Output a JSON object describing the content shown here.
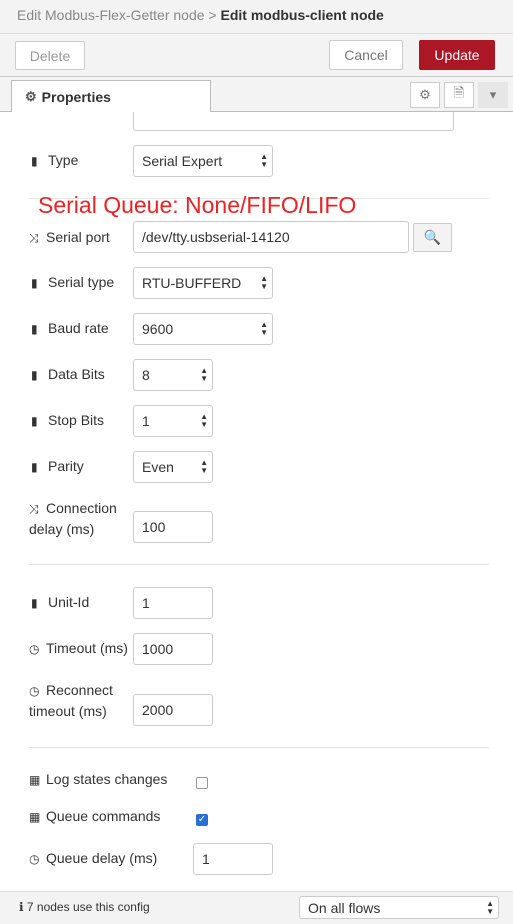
{
  "header": {
    "breadcrumb_parent": "Edit Modbus-Flex-Getter node",
    "breadcrumb_sep": ">",
    "breadcrumb_current": "Edit modbus-client node"
  },
  "toolbar": {
    "delete_label": "Delete",
    "cancel_label": "Cancel",
    "update_label": "Update"
  },
  "tabs": {
    "properties_label": "Properties"
  },
  "annotation": "Serial Queue: None/FIFO/LIFO",
  "fields": {
    "type": {
      "label": "Type",
      "value": "Serial Expert"
    },
    "serial_port": {
      "label": "Serial port",
      "value": "/dev/tty.usbserial-14120"
    },
    "serial_type": {
      "label": "Serial type",
      "value": "RTU-BUFFERD"
    },
    "baud_rate": {
      "label": "Baud rate",
      "value": "9600"
    },
    "data_bits": {
      "label": "Data Bits",
      "value": "8"
    },
    "stop_bits": {
      "label": "Stop Bits",
      "value": "1"
    },
    "parity": {
      "label": "Parity",
      "value": "Even"
    },
    "connection_delay": {
      "label_line1": "Connection",
      "label_line2": "delay (ms)",
      "value": "100"
    },
    "unit_id": {
      "label": "Unit-Id",
      "value": "1"
    },
    "timeout": {
      "label": "Timeout (ms)",
      "value": "1000"
    },
    "reconnect_timeout": {
      "label_line1": "Reconnect",
      "label_line2": "timeout (ms)",
      "value": "2000"
    },
    "log_states": {
      "label": "Log states changes",
      "checked": false
    },
    "queue_commands": {
      "label": "Queue commands",
      "checked": true
    },
    "queue_delay": {
      "label": "Queue delay (ms)",
      "value": "1"
    }
  },
  "footer": {
    "usage_text": "7 nodes use this config",
    "scope_value": "On all flows"
  },
  "colors": {
    "accent": "#ad1625",
    "annotation": "#ee2222",
    "checkbox": "#2a6dd6"
  }
}
